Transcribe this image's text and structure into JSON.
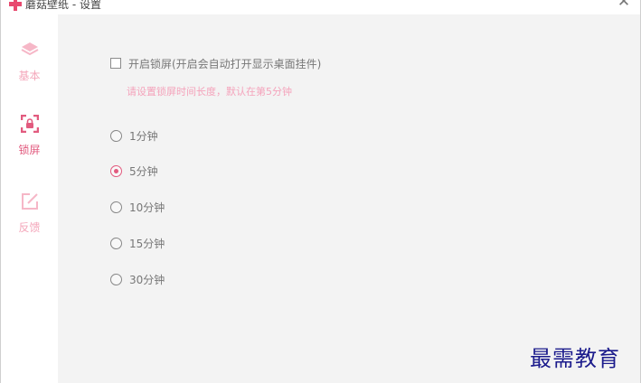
{
  "window": {
    "title": "蘑菇壁纸 - 设置",
    "close_glyph": "✕",
    "accent_color": "#e25b7f"
  },
  "sidebar": {
    "items": [
      {
        "label": "基本",
        "icon": "layers-icon",
        "active": false
      },
      {
        "label": "锁屏",
        "icon": "lock-screen-icon",
        "active": true
      },
      {
        "label": "反馈",
        "icon": "edit-icon",
        "active": false
      }
    ]
  },
  "lock_settings": {
    "enable_label": "开启锁屏(开启会自动打开显示桌面挂件)",
    "enable_checked": false,
    "hint": "请设置锁屏时间长度，默认在第5分钟",
    "options": [
      {
        "label": "1分钟",
        "checked": false
      },
      {
        "label": "5分钟",
        "checked": true
      },
      {
        "label": "10分钟",
        "checked": false
      },
      {
        "label": "15分钟",
        "checked": false
      },
      {
        "label": "30分钟",
        "checked": false
      }
    ]
  },
  "watermark": {
    "text": "最需教育"
  }
}
